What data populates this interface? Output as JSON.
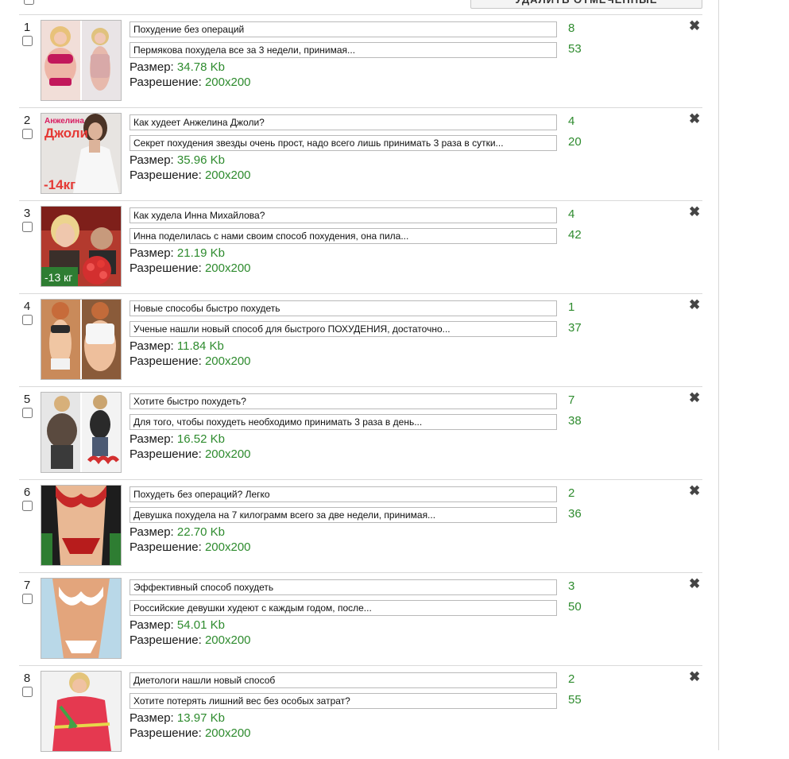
{
  "toolbar": {
    "delete_selected_label": "УДАЛИТЬ ОТМЕЧЕННЫЕ"
  },
  "labels": {
    "size": "Размер: ",
    "resolution": "Разрешение: "
  },
  "colors": {
    "value_green": "#2e8b2e",
    "border": "#d9d9d9"
  },
  "items": [
    {
      "num": "1",
      "title": "Похудение без операций",
      "desc": "Пермякова похудела все за 3 недели, принимая...",
      "count1": "8",
      "count2": "53",
      "size": "34.78 Kb",
      "resolution": "200x200"
    },
    {
      "num": "2",
      "title": "Как худеет Анжелина Джоли?",
      "desc": "Секрет похудения звезды очень прост, надо всего лишь принимать 3 раза в сутки...",
      "count1": "4",
      "count2": "20",
      "size": "35.96 Kb",
      "resolution": "200x200",
      "thumb_text": [
        "Анжелина",
        "Джоли",
        "-14кг"
      ]
    },
    {
      "num": "3",
      "title": "Как худела Инна Михайлова?",
      "desc": "Инна поделилась с нами своим способ похудения, она пила...",
      "count1": "4",
      "count2": "42",
      "size": "21.19 Kb",
      "resolution": "200x200",
      "thumb_text": [
        "-13 кг"
      ]
    },
    {
      "num": "4",
      "title": "Новые способы быстро похудеть",
      "desc": "Ученые нашли новый способ для быстрого ПОХУДЕНИЯ, достаточно...",
      "count1": "1",
      "count2": "37",
      "size": "11.84 Kb",
      "resolution": "200x200"
    },
    {
      "num": "5",
      "title": "Хотите быстро похудеть?",
      "desc": "Для того, чтобы похудеть необходимо принимать 3 раза в день...",
      "count1": "7",
      "count2": "38",
      "size": "16.52 Kb",
      "resolution": "200x200"
    },
    {
      "num": "6",
      "title": "Похудеть без операций? Легко",
      "desc": "Девушка похудела на 7 килограмм всего за две недели, принимая...",
      "count1": "2",
      "count2": "36",
      "size": "22.70 Kb",
      "resolution": "200x200"
    },
    {
      "num": "7",
      "title": "Эффективный способ похудеть",
      "desc": "Российские девушки худеют с каждым годом, после...",
      "count1": "3",
      "count2": "50",
      "size": "54.01 Kb",
      "resolution": "200x200"
    },
    {
      "num": "8",
      "title": "Диетологи нашли новый способ",
      "desc": "Хотите потерять лишний вес без особых затрат?",
      "count1": "2",
      "count2": "55",
      "size": "13.97 Kb",
      "resolution": "200x200"
    }
  ]
}
